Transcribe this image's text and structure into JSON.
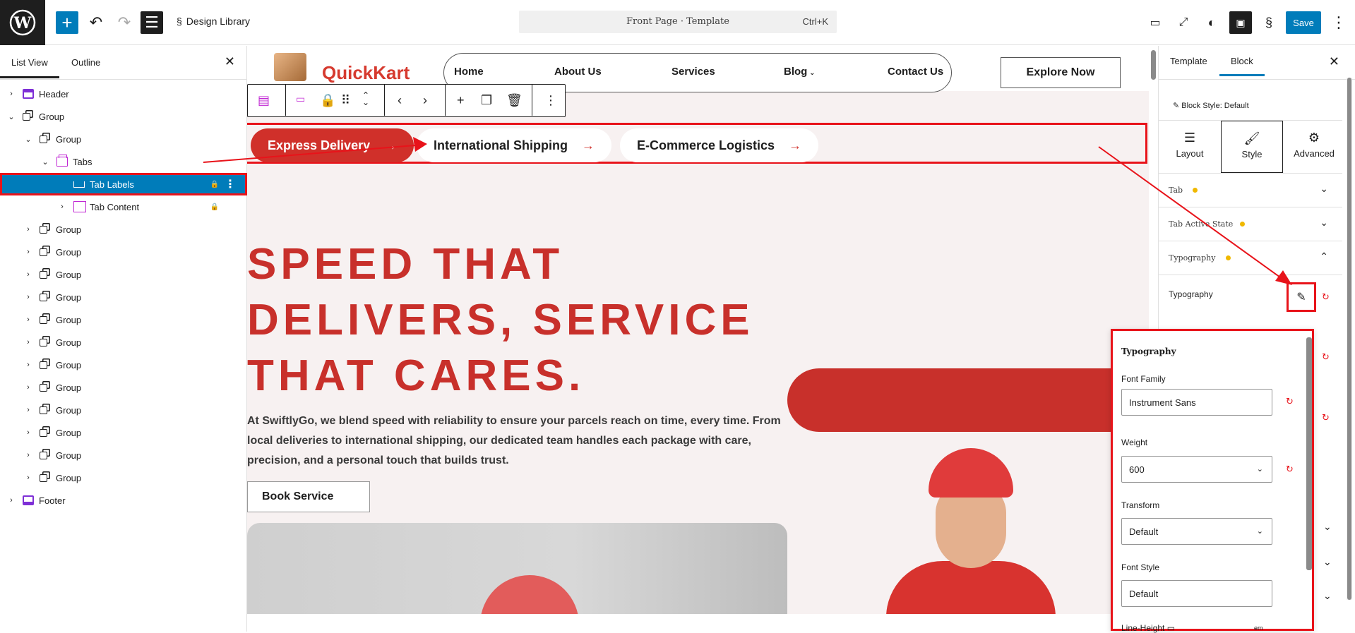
{
  "topbar": {
    "site_name": "Design Library",
    "command": "Front Page · Template",
    "shortcut": "Ctrl+K",
    "save": "Save"
  },
  "left_panel": {
    "tabs": [
      "List View",
      "Outline"
    ],
    "tree": [
      {
        "label": "Header",
        "icon": "header-icon",
        "level": 0,
        "expand": "collapsed"
      },
      {
        "label": "Group",
        "icon": "group-icon",
        "level": 0,
        "expand": "expanded"
      },
      {
        "label": "Group",
        "icon": "group-icon",
        "level": 1,
        "expand": "expanded"
      },
      {
        "label": "Tabs",
        "icon": "tabs-icon",
        "level": 2,
        "expand": "expanded"
      },
      {
        "label": "Tab Labels",
        "icon": "tab-labels-icon",
        "level": 3,
        "expand": "none",
        "selected": true,
        "locked": true
      },
      {
        "label": "Tab Content",
        "icon": "tab-content-icon",
        "level": 3,
        "expand": "collapsed",
        "locked": true
      },
      {
        "label": "Group",
        "icon": "group-icon",
        "level": 1,
        "expand": "collapsed"
      },
      {
        "label": "Group",
        "icon": "group-icon",
        "level": 1,
        "expand": "collapsed"
      },
      {
        "label": "Group",
        "icon": "group-icon",
        "level": 1,
        "expand": "collapsed"
      },
      {
        "label": "Group",
        "icon": "group-icon",
        "level": 1,
        "expand": "collapsed"
      },
      {
        "label": "Group",
        "icon": "group-icon",
        "level": 1,
        "expand": "collapsed"
      },
      {
        "label": "Group",
        "icon": "group-icon",
        "level": 1,
        "expand": "collapsed"
      },
      {
        "label": "Group",
        "icon": "group-icon",
        "level": 1,
        "expand": "collapsed"
      },
      {
        "label": "Group",
        "icon": "group-icon",
        "level": 1,
        "expand": "collapsed"
      },
      {
        "label": "Group",
        "icon": "group-icon",
        "level": 1,
        "expand": "collapsed"
      },
      {
        "label": "Group",
        "icon": "group-icon",
        "level": 1,
        "expand": "collapsed"
      },
      {
        "label": "Group",
        "icon": "group-icon",
        "level": 1,
        "expand": "collapsed"
      },
      {
        "label": "Group",
        "icon": "group-icon",
        "level": 1,
        "expand": "collapsed"
      },
      {
        "label": "Footer",
        "icon": "footer-icon",
        "level": 0,
        "expand": "collapsed"
      }
    ]
  },
  "canvas": {
    "logo": "QuickKart",
    "nav": [
      "Home",
      "About Us",
      "Services",
      "Blog",
      "Contact Us"
    ],
    "cta": "Explore Now",
    "tabs": [
      "Express Delivery",
      "International Shipping",
      "E-Commerce Logistics"
    ],
    "hero_title": "SPEED THAT DELIVERS, SERVICE THAT CARES.",
    "hero_text": "At SwiftlyGo, we blend speed with reliability to ensure your parcels reach on time, every time. From local deliveries to international shipping, our dedicated team handles each package with care, precision, and a personal touch that builds trust.",
    "book": "Book Service"
  },
  "right_panel": {
    "tabs": [
      "Template",
      "Block"
    ],
    "block_style": "Block Style: Default",
    "modes": [
      "Layout",
      "Style",
      "Advanced"
    ],
    "sections": [
      "Tab",
      "Tab Active State",
      "Typography"
    ],
    "typography_row": "Typography"
  },
  "popover": {
    "title": "Typography",
    "font_family_label": "Font Family",
    "font_family": "Instrument Sans",
    "weight_label": "Weight",
    "weight": "600",
    "transform_label": "Transform",
    "transform": "Default",
    "font_style_label": "Font Style",
    "font_style": "Default",
    "line_height_label": "Line-Height",
    "unit": "em"
  },
  "colors": {
    "accent": "#007cba",
    "brand_red": "#c8302b",
    "annotation": "#e8131a"
  }
}
